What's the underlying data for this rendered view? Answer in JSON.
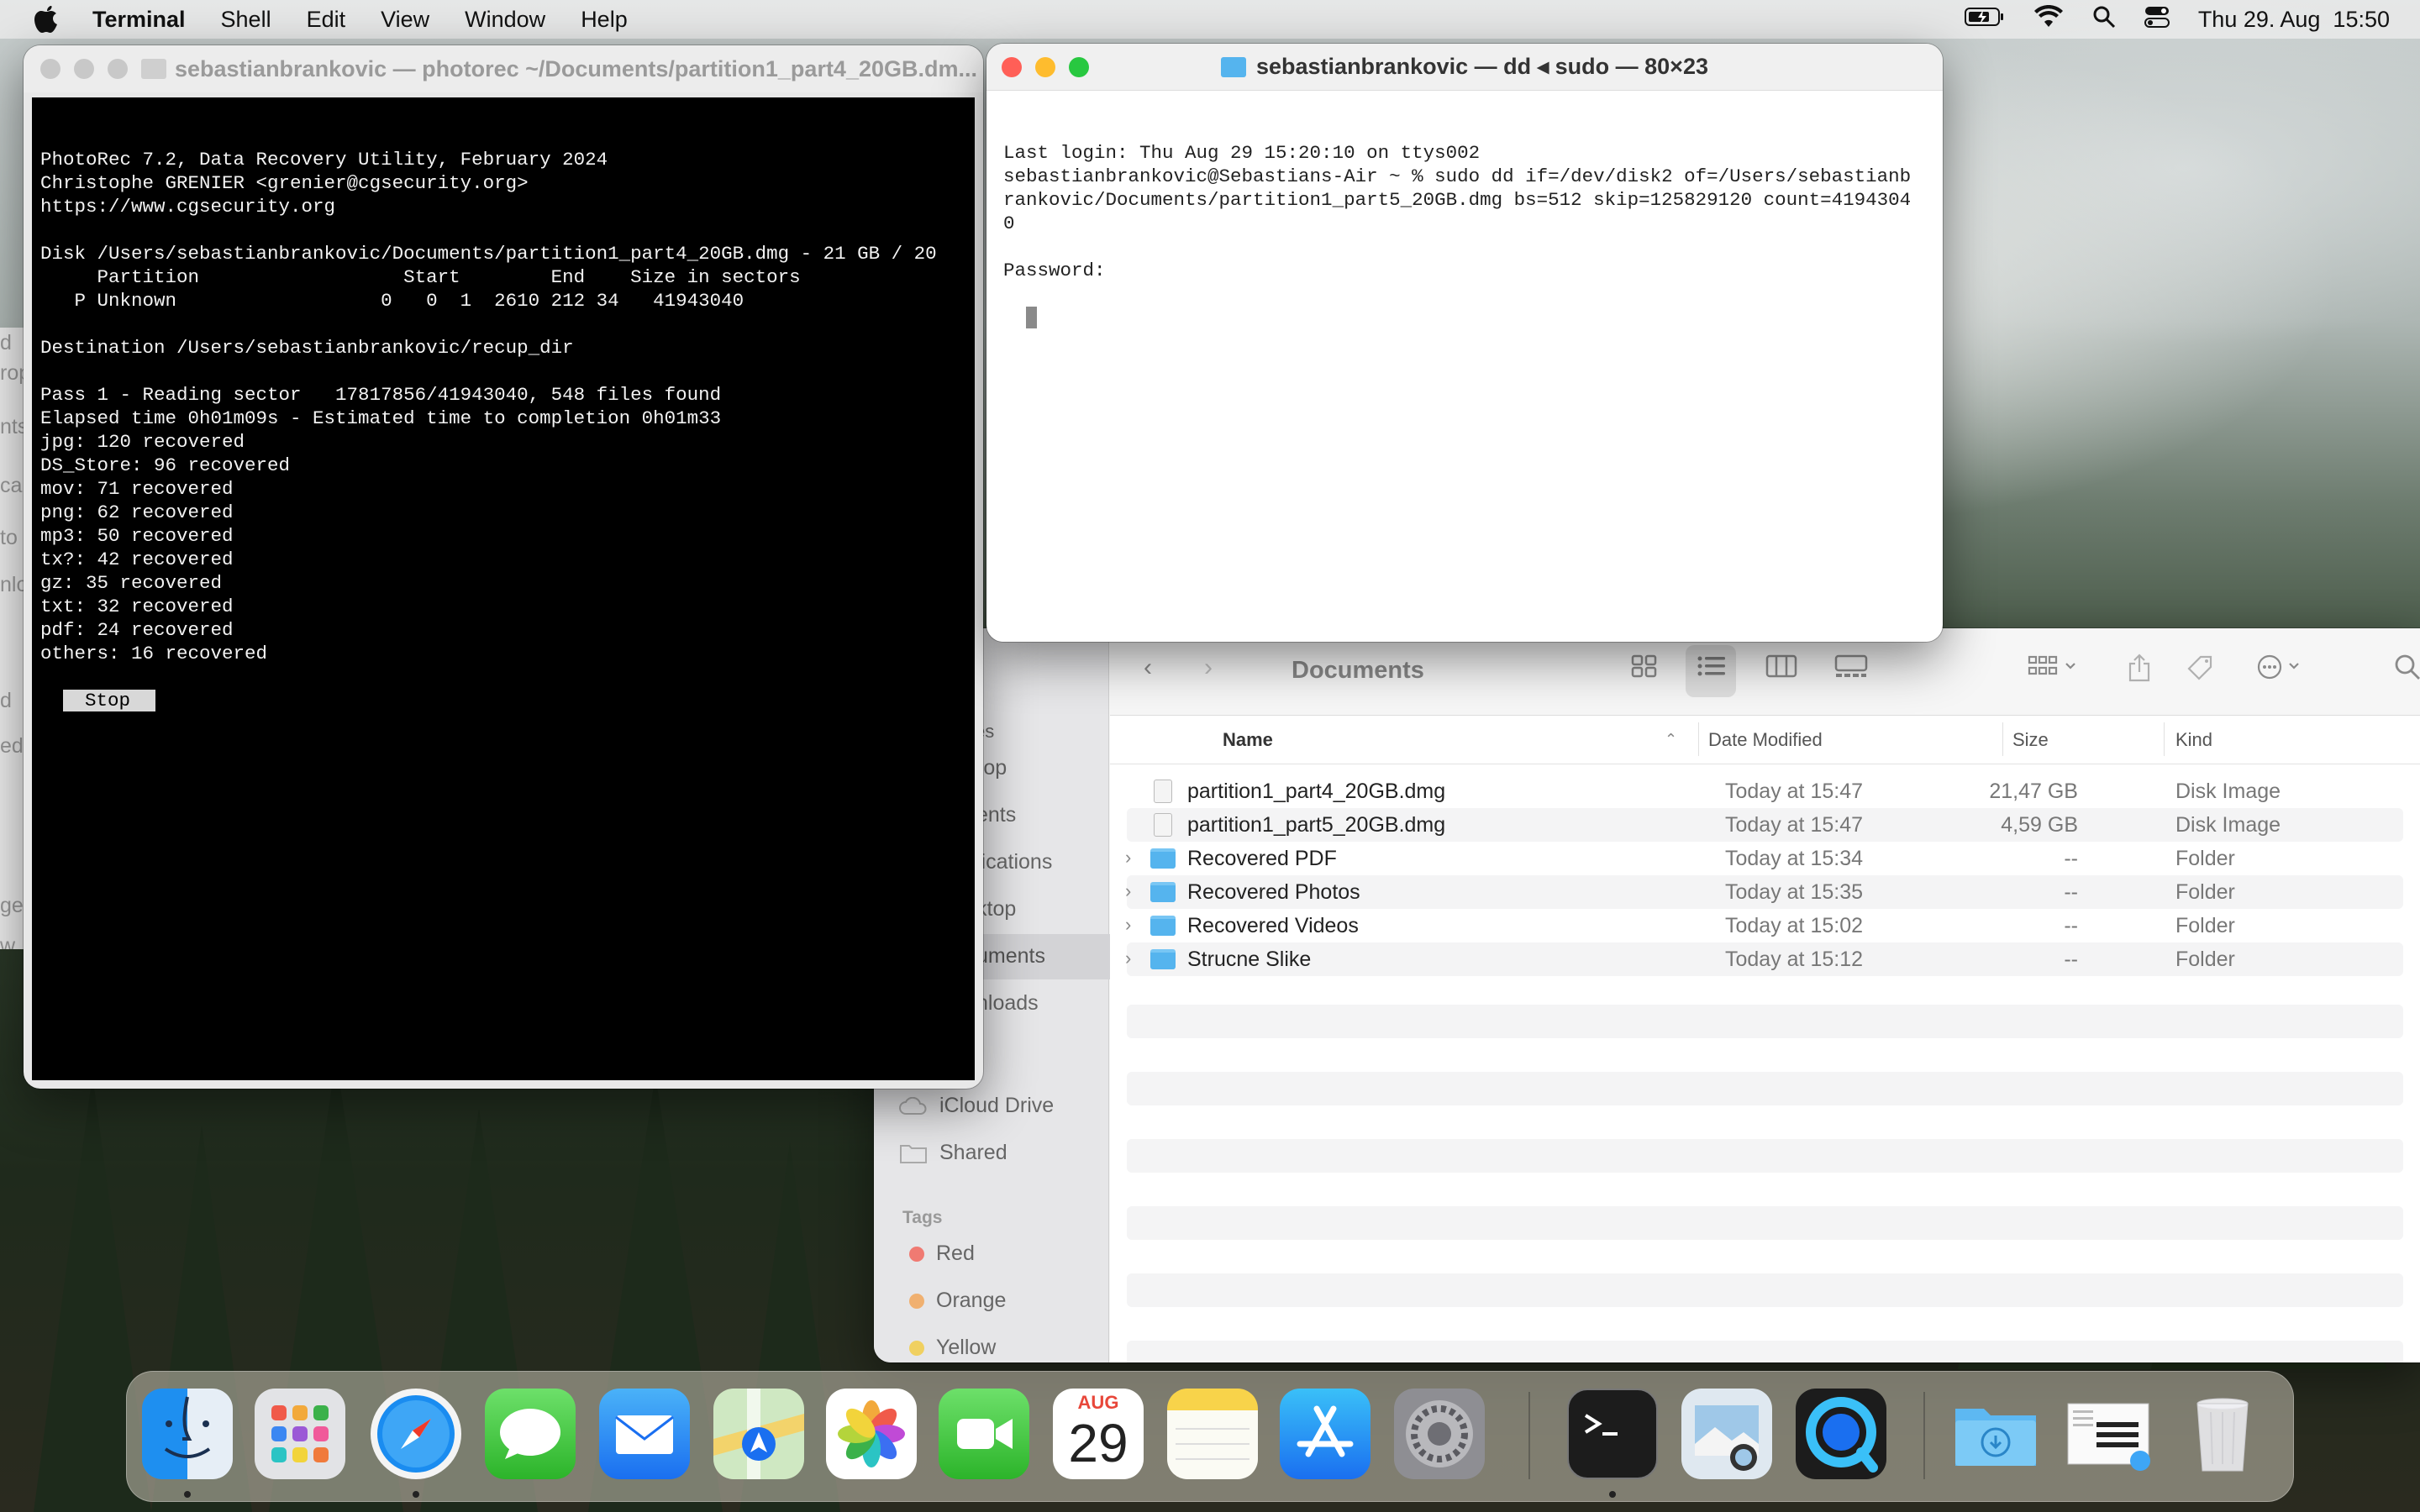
{
  "menubar": {
    "app": "Terminal",
    "items": [
      "Shell",
      "Edit",
      "View",
      "Window",
      "Help"
    ],
    "datetime": "Thu 29. Aug  15:50"
  },
  "photorec": {
    "title": "sebastianbrankovic — photorec ~/Documents/partition1_part4_20GB.dm...",
    "lines": [
      "PhotoRec 7.2, Data Recovery Utility, February 2024",
      "Christophe GRENIER <grenier@cgsecurity.org>",
      "https://www.cgsecurity.org",
      "",
      "Disk /Users/sebastianbrankovic/Documents/partition1_part4_20GB.dmg - 21 GB / 20",
      "     Partition                  Start        End    Size in sectors",
      "   P Unknown                  0   0  1  2610 212 34   41943040",
      "",
      "Destination /Users/sebastianbrankovic/recup_dir",
      "",
      "Pass 1 - Reading sector   17817856/41943040, 548 files found",
      "Elapsed time 0h01m09s - Estimated time to completion 0h01m33",
      "jpg: 120 recovered",
      "DS_Store: 96 recovered",
      "mov: 71 recovered",
      "png: 62 recovered",
      "mp3: 50 recovered",
      "tx?: 42 recovered",
      "gz: 35 recovered",
      "txt: 32 recovered",
      "pdf: 24 recovered",
      "others: 16 recovered"
    ],
    "stop": "Stop"
  },
  "dd": {
    "title": "sebastianbrankovic — dd ◂ sudo — 80×23",
    "lines": [
      "Last login: Thu Aug 29 15:20:10 on ttys002",
      "sebastianbrankovic@Sebastians-Air ~ % sudo dd if=/dev/disk2 of=/Users/sebastianb",
      "rankovic/Documents/partition1_part5_20GB.dmg bs=512 skip=125829120 count=4194304",
      "0",
      "",
      "Password:"
    ]
  },
  "finder": {
    "title": "Documents",
    "sidebar": {
      "frag": [
        "es",
        "rop",
        "ents",
        "lications",
        "ktop",
        "uments",
        "nloads"
      ],
      "icloud": "iCloud Drive",
      "shared": "Shared",
      "tags_header": "Tags",
      "tags": [
        {
          "name": "Red",
          "color": "#f07a72"
        },
        {
          "name": "Orange",
          "color": "#f0b070"
        },
        {
          "name": "Yellow",
          "color": "#f0d060"
        }
      ]
    },
    "columns": {
      "name": "Name",
      "date": "Date Modified",
      "size": "Size",
      "kind": "Kind"
    },
    "rows": [
      {
        "name": "partition1_part4_20GB.dmg",
        "date": "Today at 15:47",
        "size": "21,47 GB",
        "kind": "Disk Image",
        "type": "dmg"
      },
      {
        "name": "partition1_part5_20GB.dmg",
        "date": "Today at 15:47",
        "size": "4,59 GB",
        "kind": "Disk Image",
        "type": "dmg"
      },
      {
        "name": "Recovered PDF",
        "date": "Today at 15:34",
        "size": "--",
        "kind": "Folder",
        "type": "folder"
      },
      {
        "name": "Recovered Photos",
        "date": "Today at 15:35",
        "size": "--",
        "kind": "Folder",
        "type": "folder"
      },
      {
        "name": "Recovered Videos",
        "date": "Today at 15:02",
        "size": "--",
        "kind": "Folder",
        "type": "folder"
      },
      {
        "name": "Strucne Slike",
        "date": "Today at 15:12",
        "size": "--",
        "kind": "Folder",
        "type": "folder"
      }
    ]
  },
  "left_fragments": [
    "d",
    "rop",
    "nts",
    "ca",
    "to",
    "nlo",
    "d",
    "ed",
    "ge",
    "w"
  ],
  "dock": {
    "calendar_month": "AUG",
    "calendar_day": "29"
  }
}
